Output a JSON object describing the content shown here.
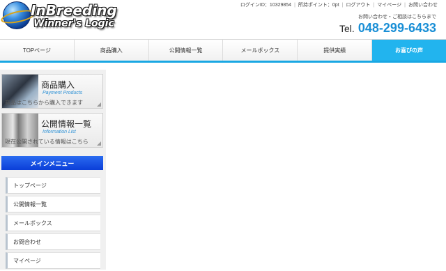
{
  "logo": {
    "line1": "InBreeding",
    "line2": "Winner's Logic"
  },
  "toplinks": {
    "login_id": "ログインID：10329854",
    "points": "所持ポイント：0pt",
    "logout": "ログアウト",
    "mypage": "マイページ",
    "contact": "お問い合わせ"
  },
  "contact_note": "お問い合わせ・ご相談はこちらまで",
  "tel": {
    "label": "Tel.",
    "number": "048-299-6433"
  },
  "nav": [
    {
      "label": "TOPページ",
      "active": false
    },
    {
      "label": "商品購入",
      "active": false
    },
    {
      "label": "公開情報一覧",
      "active": false
    },
    {
      "label": "メールボックス",
      "active": false
    },
    {
      "label": "提供実績",
      "active": false
    },
    {
      "label": "お喜びの声",
      "active": true
    }
  ],
  "banners": {
    "purchase": {
      "title": "商品購入",
      "sub": "Payment Products",
      "desc": "商品はこちらから購入できます"
    },
    "info": {
      "title": "公開情報一覧",
      "sub": "Information List",
      "desc": "現在公開されている情報はこちら"
    }
  },
  "mainmenu": {
    "heading": "メインメニュー",
    "items": [
      "トップページ",
      "公開情報一覧",
      "メールボックス",
      "お問合わせ",
      "マイページ"
    ]
  },
  "colors": {
    "accent": "#22b4ee",
    "tel": "#1a8fd6",
    "menu_head": "#0b3ed8"
  }
}
